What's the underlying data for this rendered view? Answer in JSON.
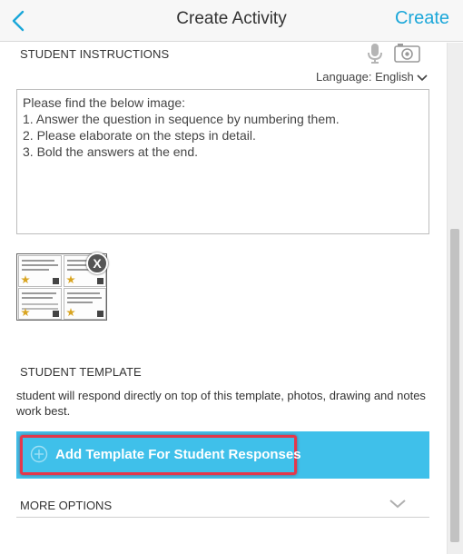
{
  "header": {
    "title": "Create Activity",
    "create_label": "Create",
    "accent_color": "#1ba7d9"
  },
  "instructions": {
    "section_title": "STUDENT INSTRUCTIONS",
    "icons": [
      "microphone-icon",
      "camera-icon",
      "chevron-down-icon"
    ],
    "language_label": "Language: English",
    "lines": [
      "Please find the below image:",
      "1. Answer the question in sequence by numbering them.",
      "2. Please elaborate on the steps in detail.",
      "3. Bold the answers at the end."
    ],
    "remove_label": "X"
  },
  "template": {
    "section_title": "STUDENT TEMPLATE",
    "description": "student will respond directly on top of this template, photos, drawing and notes work best.",
    "add_button_label": "Add Template For Student Responses",
    "bar_color": "#3fc0ea",
    "highlight_color": "#e3384b"
  },
  "more_options": {
    "label": "MORE OPTIONS"
  }
}
